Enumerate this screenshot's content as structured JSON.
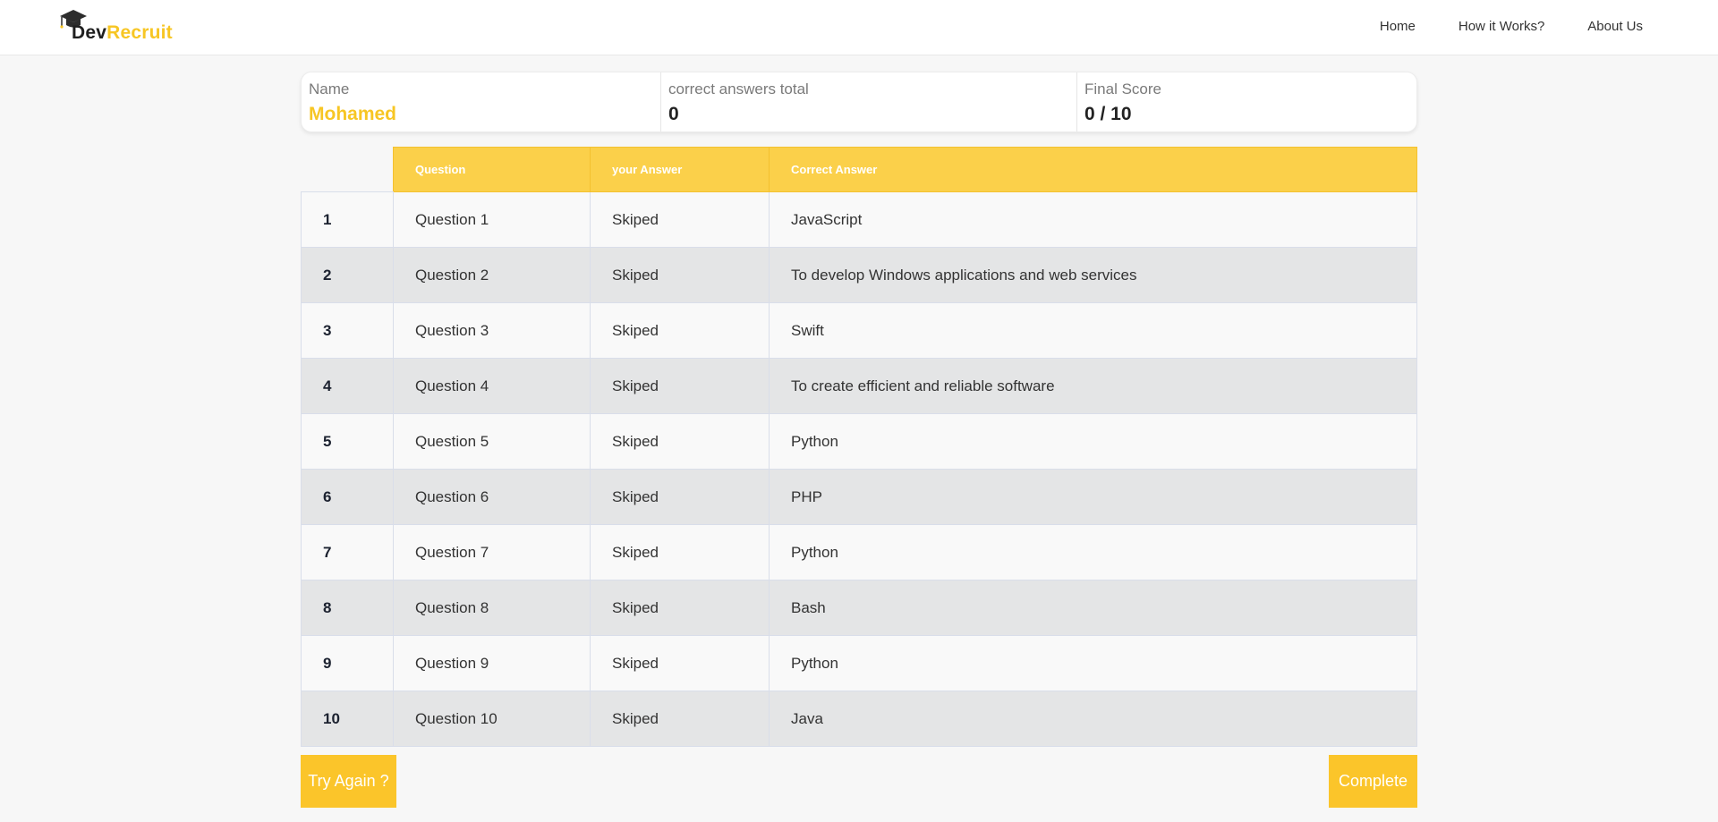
{
  "brand": {
    "part1": "Dev",
    "part2": "Recruit",
    "accent": "#f7c624",
    "icon": "graduation-cap-icon"
  },
  "nav": {
    "items": [
      {
        "label": "Home"
      },
      {
        "label": "How it Works?"
      },
      {
        "label": "About Us"
      }
    ]
  },
  "summary": {
    "name_label": "Name",
    "name_value": "Mohamed",
    "correct_label": "correct answers total",
    "correct_value": "0",
    "score_label": "Final Score",
    "score_value": "0 / 10"
  },
  "table": {
    "headers": [
      "",
      "Question",
      "your Answer",
      "Correct Answer"
    ],
    "rows": [
      {
        "num": "1",
        "question": "Question 1",
        "answer": "Skiped",
        "correct": "JavaScript"
      },
      {
        "num": "2",
        "question": "Question 2",
        "answer": "Skiped",
        "correct": "To develop Windows applications and web services"
      },
      {
        "num": "3",
        "question": "Question 3",
        "answer": "Skiped",
        "correct": "Swift"
      },
      {
        "num": "4",
        "question": "Question 4",
        "answer": "Skiped",
        "correct": "To create efficient and reliable software"
      },
      {
        "num": "5",
        "question": "Question 5",
        "answer": "Skiped",
        "correct": "Python"
      },
      {
        "num": "6",
        "question": "Question 6",
        "answer": "Skiped",
        "correct": "PHP"
      },
      {
        "num": "7",
        "question": "Question 7",
        "answer": "Skiped",
        "correct": "Python"
      },
      {
        "num": "8",
        "question": "Question 8",
        "answer": "Skiped",
        "correct": "Bash"
      },
      {
        "num": "9",
        "question": "Question 9",
        "answer": "Skiped",
        "correct": "Python"
      },
      {
        "num": "10",
        "question": "Question 10",
        "answer": "Skiped",
        "correct": "Java"
      }
    ]
  },
  "buttons": {
    "try_again": "Try Again ?",
    "complete": "Complete"
  },
  "colors": {
    "accent": "#fbd04a",
    "row_odd": "#f9f9f9",
    "row_even": "#e4e5e6"
  }
}
